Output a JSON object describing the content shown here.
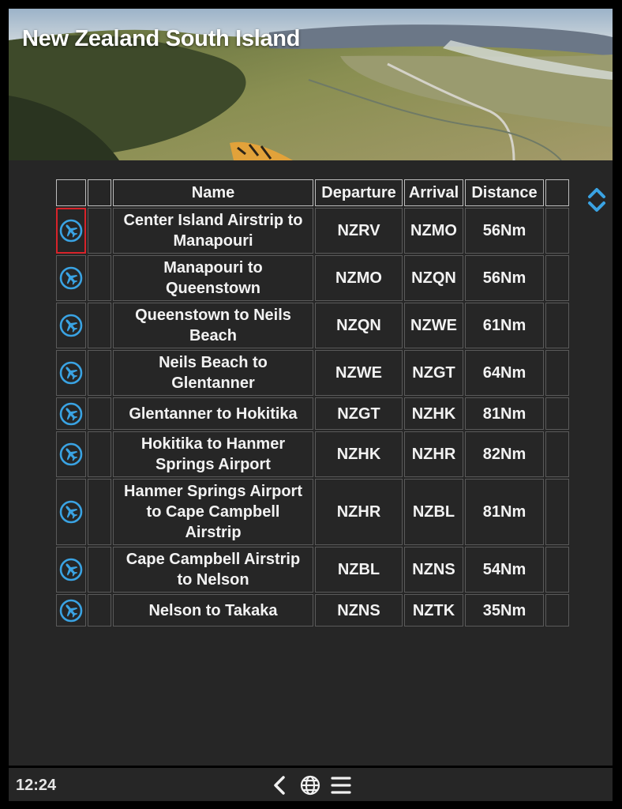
{
  "header": {
    "title": "New Zealand South Island"
  },
  "table": {
    "columns": [
      "",
      "",
      "Name",
      "Departure",
      "Arrival",
      "Distance",
      ""
    ],
    "rows": [
      {
        "name": "Center Island Airstrip to Manapouri",
        "departure": "NZRV",
        "arrival": "NZMO",
        "distance": "56Nm",
        "selected": true,
        "icon": "airplane-icon"
      },
      {
        "name": "Manapouri to Queenstown",
        "departure": "NZMO",
        "arrival": "NZQN",
        "distance": "56Nm",
        "icon": "airplane-icon"
      },
      {
        "name": "Queenstown to Neils Beach",
        "departure": "NZQN",
        "arrival": "NZWE",
        "distance": "61Nm",
        "icon": "airplane-icon"
      },
      {
        "name": "Neils Beach to Glentanner",
        "departure": "NZWE",
        "arrival": "NZGT",
        "distance": "64Nm",
        "icon": "airplane-icon"
      },
      {
        "name": "Glentanner to Hokitika",
        "departure": "NZGT",
        "arrival": "NZHK",
        "distance": "81Nm",
        "icon": "airplane-icon"
      },
      {
        "name": "Hokitika to Hanmer Springs Airport",
        "departure": "NZHK",
        "arrival": "NZHR",
        "distance": "82Nm",
        "icon": "airplane-icon"
      },
      {
        "name": "Hanmer Springs Airport to Cape Campbell Airstrip",
        "departure": "NZHR",
        "arrival": "NZBL",
        "distance": "81Nm",
        "icon": "airplane-icon"
      },
      {
        "name": "Cape Campbell Airstrip to Nelson",
        "departure": "NZBL",
        "arrival": "NZNS",
        "distance": "54Nm",
        "icon": "airplane-icon"
      },
      {
        "name": "Nelson to Takaka",
        "departure": "NZNS",
        "arrival": "NZTK",
        "distance": "35Nm",
        "icon": "airplane-icon"
      }
    ]
  },
  "scroll": {
    "up_icon": "chevron-up-icon",
    "down_icon": "chevron-down-icon"
  },
  "status_bar": {
    "time": "12:24",
    "icons": [
      "back-arrow-icon",
      "globe-icon",
      "menu-icon"
    ]
  },
  "colors": {
    "accent": "#3aa3e3",
    "selection": "#d8232a",
    "background": "#262626"
  }
}
